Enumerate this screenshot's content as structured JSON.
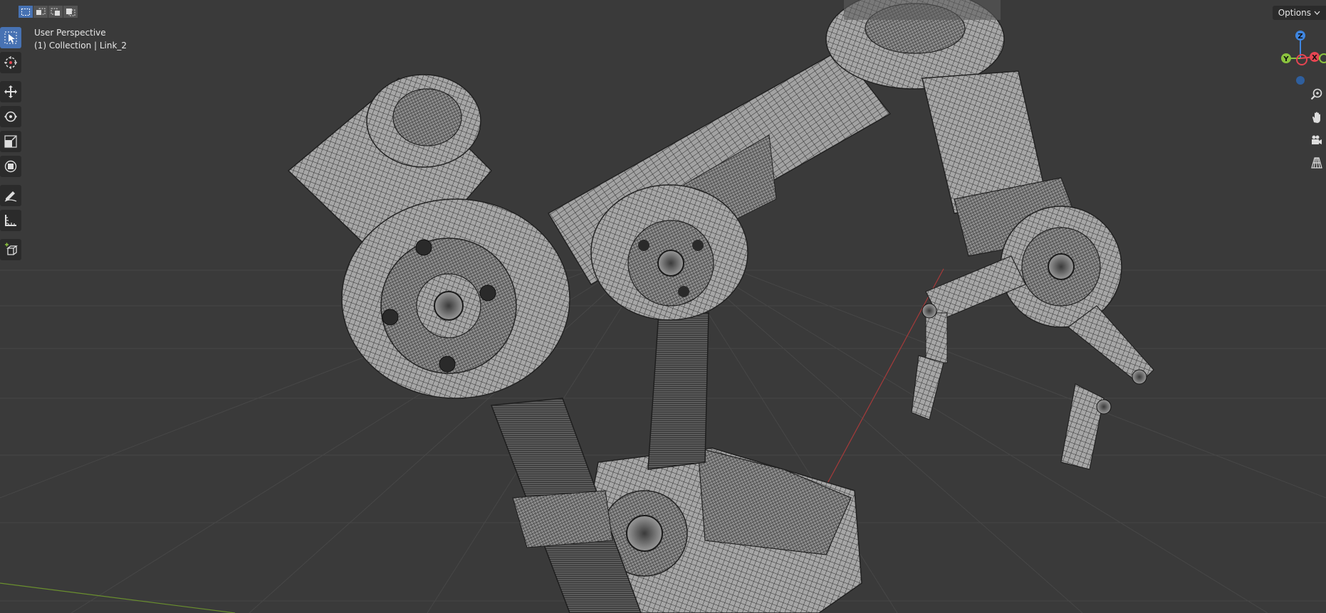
{
  "viewport": {
    "view_name": "User Perspective",
    "collection_label": "(1) Collection | Link_2"
  },
  "header": {
    "options_label": "Options",
    "options_chevron": "chevron-down-icon"
  },
  "select_modes": [
    {
      "name": "select-mode-new",
      "active": true
    },
    {
      "name": "select-mode-extend",
      "active": false
    },
    {
      "name": "select-mode-subtract",
      "active": false
    },
    {
      "name": "select-mode-invert",
      "active": false
    }
  ],
  "toolbar": {
    "tools": [
      {
        "name": "select-box-tool",
        "icon": "cursor-select-icon",
        "active": true
      },
      {
        "name": "cursor-tool",
        "icon": "3d-cursor-icon",
        "active": false
      },
      {
        "name": "move-tool",
        "icon": "move-arrows-icon",
        "active": false
      },
      {
        "name": "rotate-tool",
        "icon": "rotate-icon",
        "active": false
      },
      {
        "name": "scale-tool",
        "icon": "scale-icon",
        "active": false
      },
      {
        "name": "transform-tool",
        "icon": "transform-icon",
        "active": false
      },
      {
        "name": "annotate-tool",
        "icon": "annotate-pencil-icon",
        "active": false
      },
      {
        "name": "measure-tool",
        "icon": "measure-ruler-icon",
        "active": false
      },
      {
        "name": "add-cube-tool",
        "icon": "add-cube-icon",
        "active": false
      }
    ]
  },
  "gizmo": {
    "axes": {
      "x": "X",
      "y": "Y",
      "z": "Z"
    },
    "colors": {
      "x": "#e64552",
      "y": "#8bc33e",
      "z": "#3f86e0"
    }
  },
  "nav_buttons": [
    {
      "name": "zoom-button",
      "icon": "zoom-magnifier-icon"
    },
    {
      "name": "pan-button",
      "icon": "hand-pan-icon"
    },
    {
      "name": "camera-view-button",
      "icon": "camera-icon"
    },
    {
      "name": "perspective-toggle-button",
      "icon": "grid-perspective-icon"
    }
  ],
  "colors": {
    "background": "#3a3a3a",
    "grid_line": "#444444",
    "x_axis_line": "#a63a3a",
    "y_axis_line": "#6a8f2e",
    "model_fill": "#9a9a9a",
    "model_wire": "#2a2a2a",
    "accent": "#4772b3"
  }
}
